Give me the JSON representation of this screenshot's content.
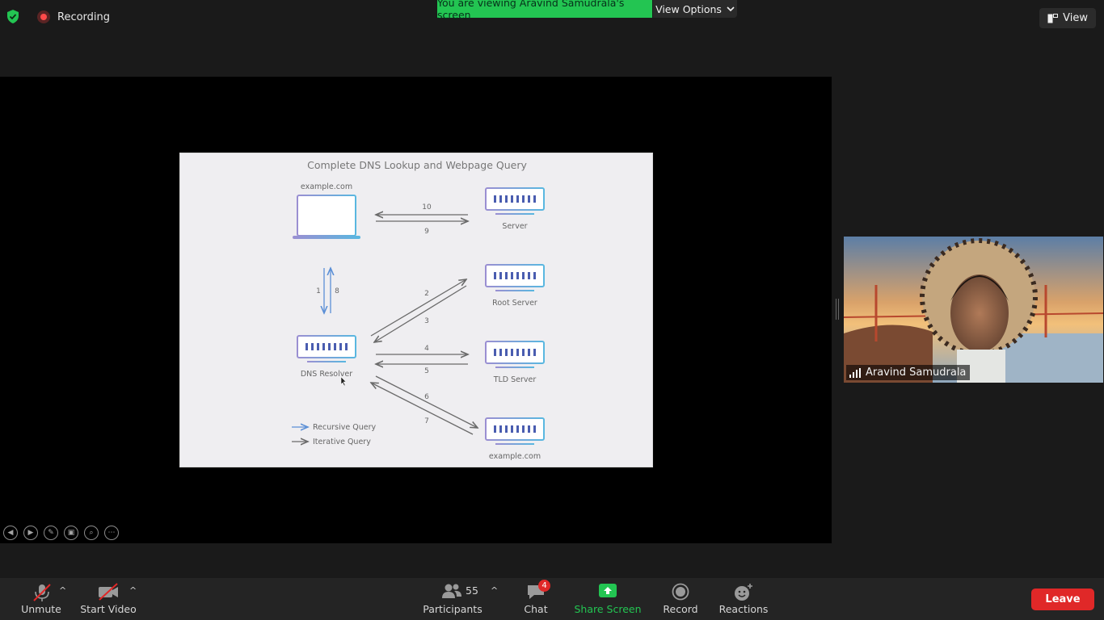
{
  "topbar": {
    "recording_label": "Recording",
    "banner_text": "You are viewing Aravind Samudrala's screen",
    "view_options_label": "View Options",
    "view_label": "View"
  },
  "slide": {
    "title": "Complete DNS Lookup and Webpage Query",
    "client_label": "example.com",
    "server_label": "Server",
    "root_label": "Root Server",
    "tld_label": "TLD Server",
    "authoritative_label": "example.com",
    "resolver_label": "DNS Resolver",
    "step_labels": [
      "1",
      "2",
      "3",
      "4",
      "5",
      "6",
      "7",
      "8",
      "9",
      "10"
    ],
    "legend": {
      "recursive": "Recursive Query",
      "iterative": "Iterative Query"
    },
    "colors": {
      "recursive_arrow": "#5b8fd6",
      "iterative_arrow": "#6a6a6a",
      "server_accent": "#4a5db0"
    }
  },
  "participant": {
    "name": "Aravind Samudrala"
  },
  "toolbar": {
    "unmute": "Unmute",
    "start_video": "Start Video",
    "participants_count": "55",
    "participants": "Participants",
    "chat_badge": "4",
    "chat": "Chat",
    "share_screen": "Share Screen",
    "record": "Record",
    "reactions": "Reactions",
    "leave": "Leave",
    "colors": {
      "share_green": "#23c552",
      "leave_red": "#e02828"
    }
  }
}
